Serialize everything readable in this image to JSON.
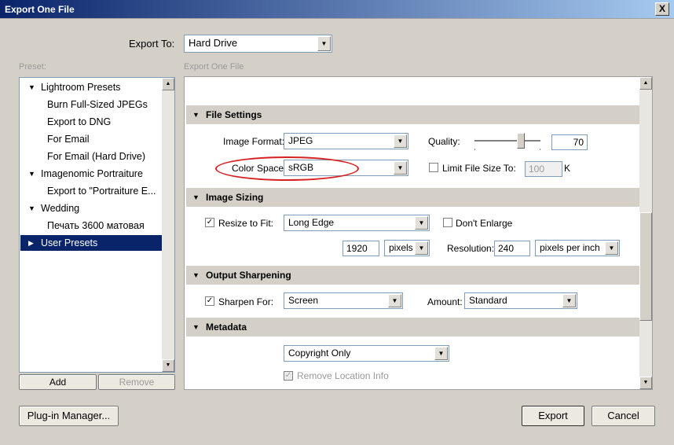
{
  "window": {
    "title": "Export One File",
    "close_glyph": "X"
  },
  "export_to": {
    "label": "Export To:",
    "value": "Hard Drive"
  },
  "preset": {
    "label": "Preset:",
    "items": [
      {
        "label": "Lightroom Presets",
        "type": "group",
        "expanded": true
      },
      {
        "label": "Burn Full-Sized JPEGs",
        "type": "item"
      },
      {
        "label": "Export to DNG",
        "type": "item"
      },
      {
        "label": "For Email",
        "type": "item"
      },
      {
        "label": "For Email (Hard Drive)",
        "type": "item"
      },
      {
        "label": "Imagenomic Portraiture",
        "type": "group",
        "expanded": true
      },
      {
        "label": "Export to \"Portraiture E...",
        "type": "item"
      },
      {
        "label": "Wedding",
        "type": "group",
        "expanded": true
      },
      {
        "label": "Печать 3600 матовая",
        "type": "item"
      },
      {
        "label": "User Presets",
        "type": "group",
        "expanded": false,
        "selected": true
      }
    ],
    "add_label": "Add",
    "remove_label": "Remove"
  },
  "panel_header": "Export One File",
  "file_settings": {
    "title": "File Settings",
    "format_label": "Image Format:",
    "format_value": "JPEG",
    "quality_label": "Quality:",
    "quality_value": "70",
    "quality_fraction": 0.7,
    "color_space_label": "Color Space:",
    "color_space_value": "sRGB",
    "limit_label": "Limit File Size To:",
    "limit_checked": false,
    "limit_value": "100",
    "limit_unit": "K"
  },
  "image_sizing": {
    "title": "Image Sizing",
    "resize_label": "Resize to Fit:",
    "resize_checked": true,
    "resize_value": "Long Edge",
    "dont_enlarge_label": "Don't Enlarge",
    "size_value": "1920",
    "size_unit": "pixels",
    "resolution_label": "Resolution:",
    "resolution_value": "240",
    "resolution_unit": "pixels per inch"
  },
  "output_sharpening": {
    "title": "Output Sharpening",
    "sharpen_label": "Sharpen For:",
    "sharpen_checked": true,
    "sharpen_value": "Screen",
    "amount_label": "Amount:",
    "amount_value": "Standard"
  },
  "metadata": {
    "title": "Metadata",
    "value": "Copyright Only",
    "remove_location_label": "Remove Location Info"
  },
  "footer": {
    "plugin_label": "Plug-in Manager...",
    "export_label": "Export",
    "cancel_label": "Cancel"
  },
  "colors": {
    "title_start": "#0a246a",
    "title_end": "#a6caf0",
    "selection": "#0a246a",
    "highlight_oval": "#d92020"
  }
}
